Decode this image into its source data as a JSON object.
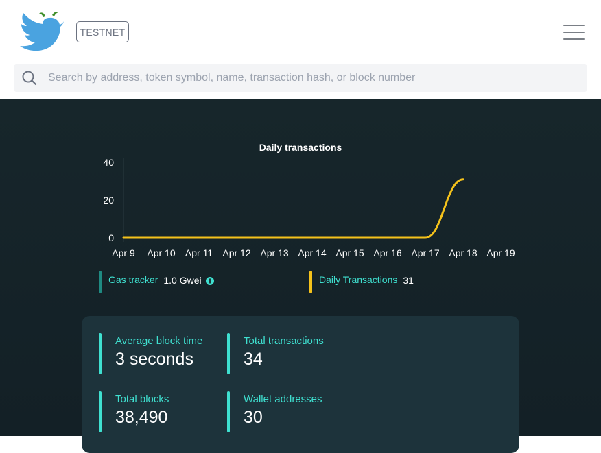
{
  "header": {
    "network_badge": "TESTNET",
    "search_placeholder": "Search by address, token symbol, name, transaction hash, or block number"
  },
  "chart_data": {
    "type": "line",
    "title": "Daily transactions",
    "categories": [
      "Apr 9",
      "Apr 10",
      "Apr 11",
      "Apr 12",
      "Apr 13",
      "Apr 14",
      "Apr 15",
      "Apr 16",
      "Apr 17",
      "Apr 18",
      "Apr 19"
    ],
    "series": [
      {
        "values": [
          0,
          0,
          0,
          0,
          0,
          0,
          0,
          0,
          0,
          31
        ],
        "color": "#f5c21b"
      }
    ],
    "yticks": [
      0,
      20,
      40
    ],
    "ylim": [
      0,
      40
    ],
    "grid": false,
    "xlabel": "",
    "ylabel": ""
  },
  "legend": {
    "gas_tracker_label": "Gas tracker",
    "gas_tracker_value": "1.0 Gwei",
    "gas_color": "#1f8a82",
    "daily_tx_label": "Daily Transactions",
    "daily_tx_value": "31",
    "daily_tx_color": "#f5c21b"
  },
  "stats": [
    {
      "label": "Average block time",
      "value": "3 seconds"
    },
    {
      "label": "Total transactions",
      "value": "34"
    },
    {
      "label": "Total blocks",
      "value": "38,490"
    },
    {
      "label": "Wallet addresses",
      "value": "30"
    }
  ],
  "colors": {
    "accent": "#3fe0d0",
    "dark_bg": "#17262b",
    "card_bg": "#1d333b"
  }
}
